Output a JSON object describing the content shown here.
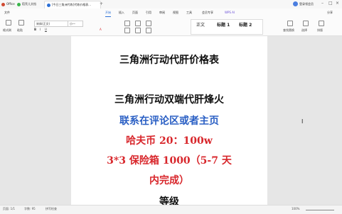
{
  "titlebar": {
    "tabs": [
      {
        "label": "Office",
        "color": "#d04a32"
      },
      {
        "label": "稻壳儿文档",
        "color": "#39b54a"
      },
      {
        "label": "[今日三角洲代练]代练价格表…",
        "color": "#2b6fd6"
      }
    ],
    "user": "登录领会员"
  },
  "menu": {
    "items": [
      "文件",
      "开始",
      "插入",
      "页面",
      "引用",
      "审阅",
      "视图",
      "工具",
      "会员专享",
      "WPS AI"
    ],
    "active": "开始",
    "share": "分享"
  },
  "ribbon": {
    "left_labels": [
      "格式刷",
      "粘贴"
    ],
    "font_name": "宋体(正文)",
    "font_size": "小一",
    "styles": [
      "正文",
      "标题 1",
      "标题 2"
    ],
    "right_labels": [
      "查找替换",
      "选择",
      "排版"
    ]
  },
  "document": {
    "lines": [
      {
        "text": "三角洲行动代肝价格表",
        "color": "#111111"
      },
      {
        "text": "三角洲行动双端代肝烽火",
        "color": "#111111"
      },
      {
        "text": "联系在评论区或者主页",
        "color": "#2a5fc4"
      },
      {
        "text": "哈夫币 20：100w",
        "color": "#d8262b"
      },
      {
        "text": "3*3 保险箱 1000（5-7 天",
        "color": "#d8262b"
      },
      {
        "text": "内完成）",
        "color": "#d8262b"
      },
      {
        "text": "等级",
        "color": "#111111"
      }
    ]
  },
  "status": {
    "page": "页面: 1/1",
    "words": "字数: 95",
    "spell": "拼写检查",
    "zoom": "100%"
  }
}
